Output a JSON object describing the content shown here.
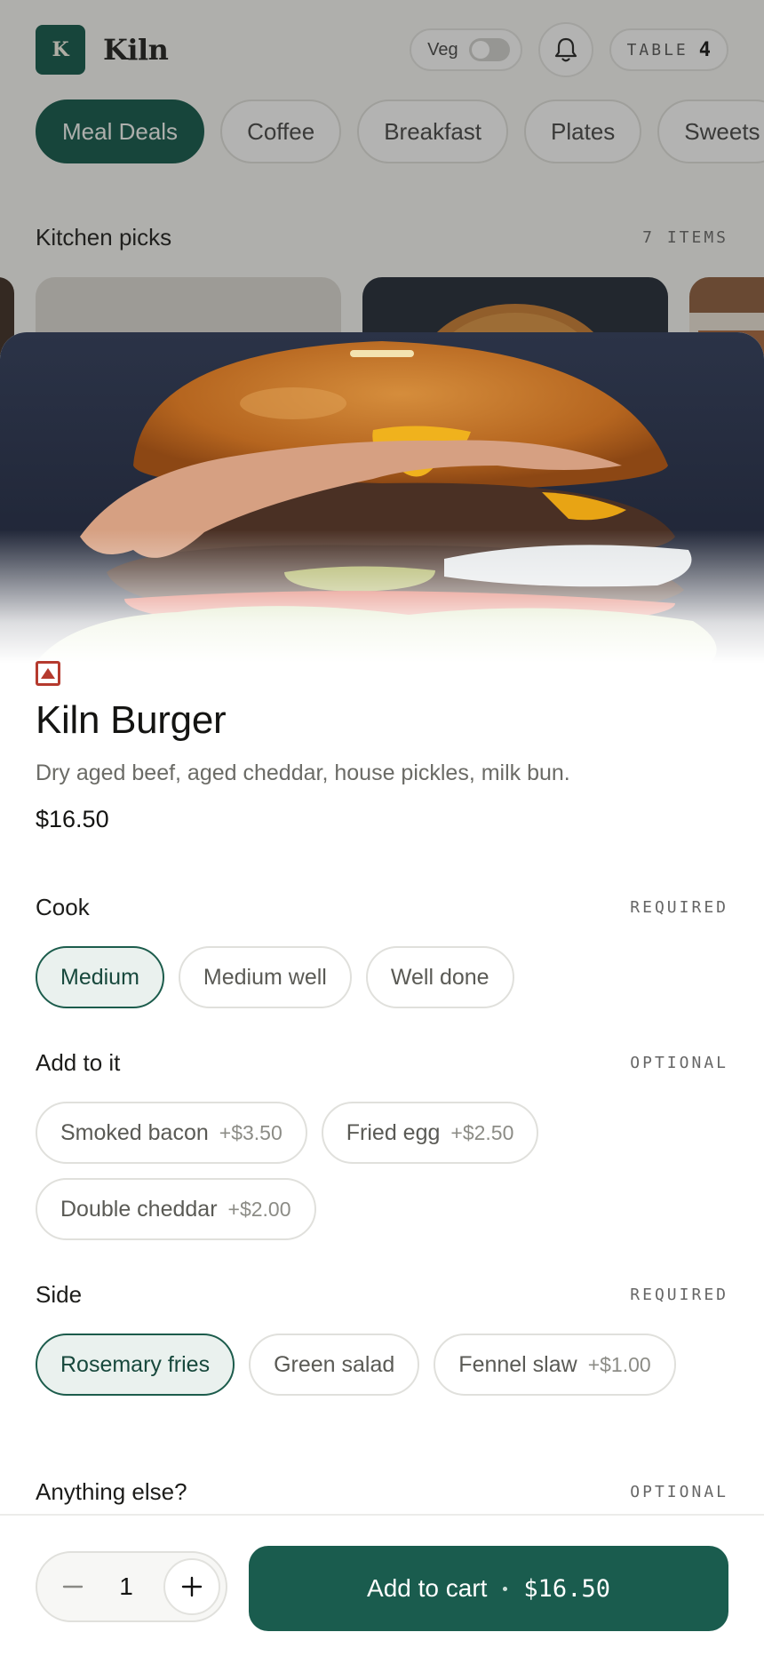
{
  "app": {
    "logo_letter": "K",
    "name": "Kiln"
  },
  "header": {
    "veg_label": "Veg",
    "table_label": "TABLE",
    "table_number": "4"
  },
  "categories": [
    {
      "label": "Meal Deals",
      "active": true
    },
    {
      "label": "Coffee"
    },
    {
      "label": "Breakfast"
    },
    {
      "label": "Plates"
    },
    {
      "label": "Sweets"
    }
  ],
  "section": {
    "title": "Kitchen picks",
    "count": "7 ITEMS"
  },
  "item": {
    "title": "Kiln Burger",
    "description": "Dry aged beef, aged cheddar, house pickles, milk bun.",
    "price": "$16.50"
  },
  "options": {
    "cook": {
      "title": "Cook",
      "tag": "REQUIRED",
      "choices": [
        {
          "label": "Medium",
          "selected": true
        },
        {
          "label": "Medium well"
        },
        {
          "label": "Well done"
        }
      ]
    },
    "addons": {
      "title": "Add to it",
      "tag": "OPTIONAL",
      "choices": [
        {
          "label": "Smoked bacon",
          "price": "+$3.50"
        },
        {
          "label": "Fried egg",
          "price": "+$2.50"
        },
        {
          "label": "Double cheddar",
          "price": "+$2.00"
        }
      ]
    },
    "side": {
      "title": "Side",
      "tag": "REQUIRED",
      "choices": [
        {
          "label": "Rosemary fries",
          "selected": true
        },
        {
          "label": "Green salad"
        },
        {
          "label": "Fennel slaw",
          "price": "+$1.00"
        }
      ]
    },
    "notes": {
      "title": "Anything else?",
      "tag": "OPTIONAL"
    }
  },
  "footer": {
    "quantity": "1",
    "add_label": "Add to cart",
    "add_price": "$16.50"
  },
  "colors": {
    "brand": "#0f5446",
    "button": "#1a5c4e",
    "nonveg": "#b53a2e"
  },
  "icons": {
    "bell": "bell-icon",
    "minus": "minus-icon",
    "plus": "plus-icon",
    "nonveg": "non-veg-icon"
  }
}
